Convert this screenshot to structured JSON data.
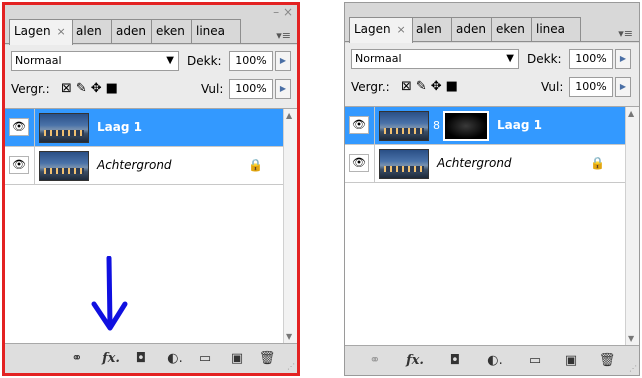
{
  "panels": [
    {
      "tabs": [
        {
          "label": "Lagen",
          "close": "×"
        },
        {
          "label": "alen"
        },
        {
          "label": "aden"
        },
        {
          "label": "eken"
        },
        {
          "label": "linea"
        }
      ],
      "window_icons": "– ×",
      "menu_icon": "▾≡",
      "blend_mode": "Normaal",
      "opacity_label": "Dekk:",
      "opacity_value": "100%",
      "lock_label": "Vergr.:",
      "fill_label": "Vul:",
      "fill_value": "100%",
      "layers": [
        {
          "name": "Laag 1",
          "selected": true,
          "eye": "👁"
        },
        {
          "name": "Achtergrond",
          "selected": false,
          "eye": "👁",
          "lock": "🔒"
        }
      ],
      "bottom_icons": {
        "link": "⚭",
        "fx": "fx.",
        "mask": "◘",
        "adjust": "◐.",
        "folder": "▭",
        "new": "▣",
        "trash": "🗑"
      }
    },
    {
      "tabs": [
        {
          "label": "Lagen",
          "close": "×"
        },
        {
          "label": "alen"
        },
        {
          "label": "aden"
        },
        {
          "label": "eken"
        },
        {
          "label": "linea"
        }
      ],
      "menu_icon": "▾≡",
      "blend_mode": "Normaal",
      "opacity_label": "Dekk:",
      "opacity_value": "100%",
      "lock_label": "Vergr.:",
      "fill_label": "Vul:",
      "fill_value": "100%",
      "layers": [
        {
          "name": "Laag 1",
          "selected": true,
          "eye": "👁",
          "chain": "8"
        },
        {
          "name": "Achtergrond",
          "selected": false,
          "eye": "👁",
          "lock": "🔒"
        }
      ],
      "bottom_icons": {
        "link": "⚭",
        "fx": "fx.",
        "mask": "◘",
        "adjust": "◐.",
        "folder": "▭",
        "new": "▣",
        "trash": "🗑"
      }
    }
  ],
  "colors": {
    "selection": "#3399ff",
    "highlight_border": "#e32222",
    "arrow": "#1010e0"
  }
}
